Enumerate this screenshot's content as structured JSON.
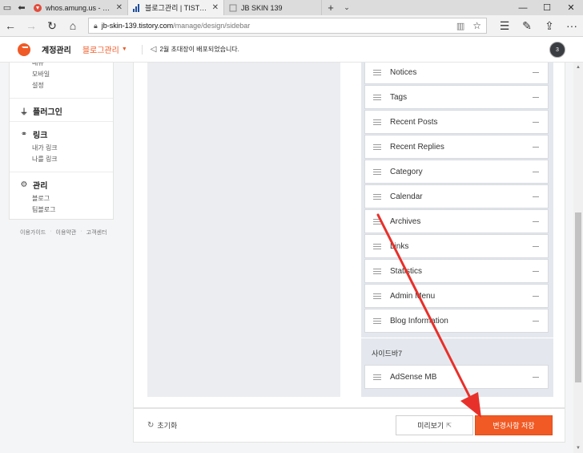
{
  "browser": {
    "tabs": [
      {
        "title": "whos.amung.us - real-time :",
        "favicon_color": "#e24c3b",
        "active": false
      },
      {
        "title": "블로그관리 | TISTORY",
        "favicon_color": "#1d4e9e",
        "active": true
      },
      {
        "title": "JB SKIN 139",
        "favicon_color": "#999999",
        "active": false
      }
    ],
    "url_host": "jb-skin-139.tistory.com",
    "url_path": "/manage/design/sidebar"
  },
  "header": {
    "account_menu": "계정관리",
    "blog_menu": "블로그관리",
    "notice": "2월 초대장이 배포되었습니다.",
    "avatar_text": "3"
  },
  "side_nav": {
    "design_links": [
      "메뉴",
      "모바일",
      "설정"
    ],
    "plugin_title": "플러그인",
    "link_title": "링크",
    "link_links": [
      "내가 링크",
      "나를 링크"
    ],
    "manage_title": "관리",
    "manage_links": [
      "블로그",
      "팀블로그"
    ],
    "footer_links": [
      "이용가이드",
      "이용약관",
      "고객센터"
    ]
  },
  "modules": [
    "Notices",
    "Tags",
    "Recent Posts",
    "Recent Replies",
    "Category",
    "Calendar",
    "Archives",
    "Links",
    "Statistics",
    "Admin Menu",
    "Blog Information"
  ],
  "sidebar7": {
    "title": "사이드바7",
    "modules": [
      "AdSense MB"
    ]
  },
  "actions": {
    "reset": "초기화",
    "preview": "미리보기",
    "save": "변경사항 저장"
  },
  "colors": {
    "accent": "#f15a24",
    "annotation_arrow": "#e8302a"
  }
}
